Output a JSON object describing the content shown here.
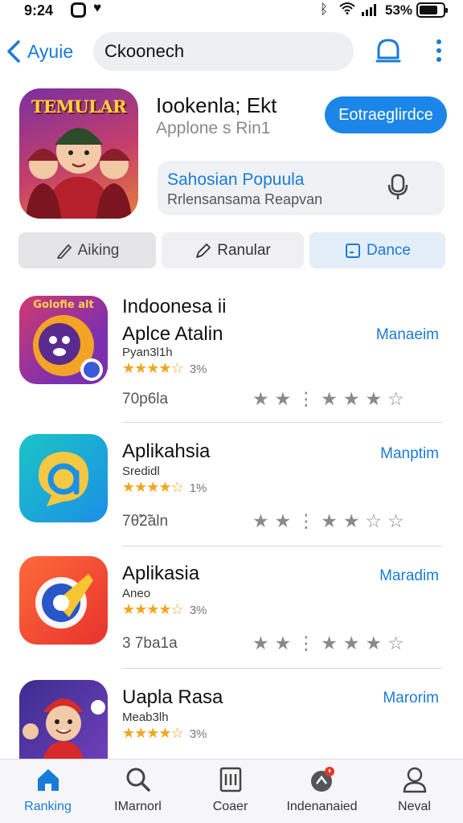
{
  "status_bar": {
    "time": "9:24",
    "battery": "53%"
  },
  "nav": {
    "back_label": "Ayuie",
    "search_value": "Ckoonech"
  },
  "featured": {
    "icon_title": "TEMULAR",
    "name": "Iookenla; Ekt",
    "subtitle": "Applone s Rin1",
    "action_label": "Eotraeglirdce",
    "promo_title": "Sahosian Popuula",
    "promo_subtitle": "Rrlensansama Reapvan"
  },
  "filters": [
    {
      "label": "Aiking",
      "icon": "pen-icon"
    },
    {
      "label": "Ranular",
      "icon": "pencil-icon"
    },
    {
      "label": "Dance",
      "icon": "square-icon"
    }
  ],
  "apps": [
    {
      "name": "Indoonesa ii",
      "name_line2": "Aplce Atalin",
      "developer": "Pyan3l1h",
      "stars": "★★★★☆",
      "percent": "3%",
      "size": "70p6la",
      "action": "Manaeim",
      "icon_text": "Golofie alt",
      "rating_stars": "★★⋮★★★☆"
    },
    {
      "name": "Aplikahsia",
      "developer": "Sredidl",
      "stars": "★★★★☆",
      "percent": "1%",
      "size": "7θ̃2̃aln",
      "action": "Manptim",
      "rating_stars": "★★⋮★★☆☆"
    },
    {
      "name": "Aplikasia",
      "developer": "Aneo",
      "stars": "★★★★☆",
      "percent": "3%",
      "size": "3 7ba1a",
      "action": "Maradim",
      "rating_stars": "★★⋮★★★☆"
    },
    {
      "name": "Uapla Rasa",
      "developer": "Meab3lh",
      "stars": "★★★★☆",
      "percent": "3%",
      "action": "Marorim"
    }
  ],
  "tabbar": [
    {
      "label": "Ranking",
      "icon": "house-icon"
    },
    {
      "label": "IMarnorl",
      "icon": "search-icon"
    },
    {
      "label": "Coaer",
      "icon": "document-icon"
    },
    {
      "label": "Indenanaied",
      "icon": "chat-badge-icon"
    },
    {
      "label": "Neval",
      "icon": "person-icon"
    }
  ],
  "colors": {
    "accent": "#1a7bd6",
    "button": "#1b86e8",
    "star": "#f3a51b"
  }
}
